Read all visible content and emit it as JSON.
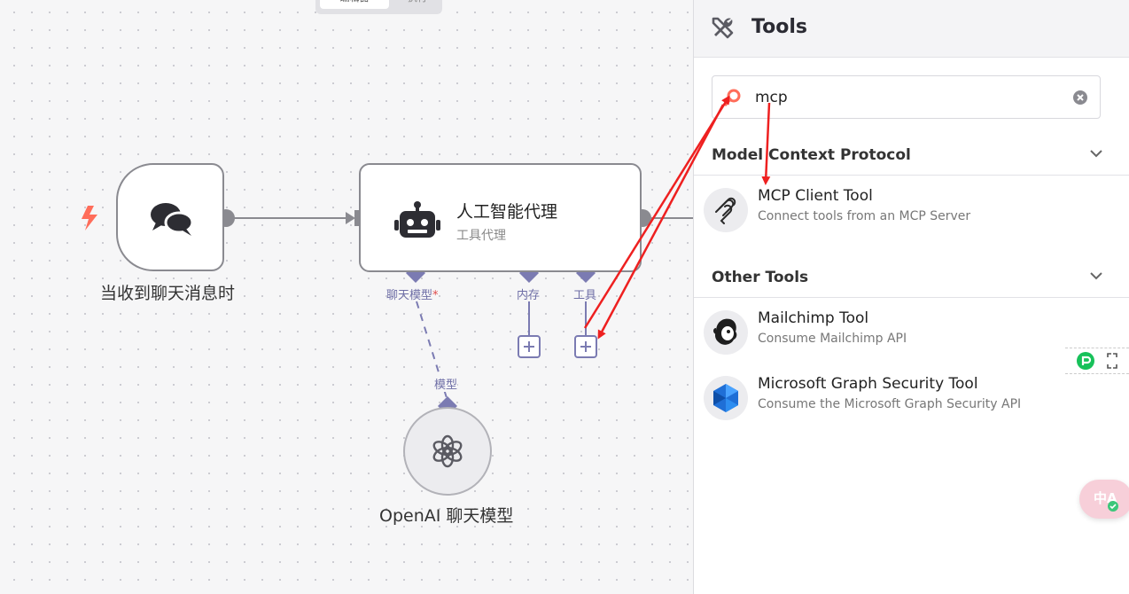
{
  "canvas": {
    "top_tabs": {
      "active": "编辑器",
      "inactive": "执行"
    },
    "trigger_node": {
      "label": "当收到聊天消息时",
      "icon": "chat-bubbles-icon",
      "trigger_icon": "lightning-icon"
    },
    "agent_node": {
      "title": "人工智能代理",
      "subtitle": "工具代理",
      "icon": "robot-icon",
      "ports": {
        "chat_model": "聊天模型",
        "required_mark": "*",
        "memory": "内存",
        "tool": "工具"
      }
    },
    "model_node": {
      "label": "OpenAI 聊天模型",
      "port_label": "模型",
      "icon": "openai-icon"
    }
  },
  "panel": {
    "title": "Tools",
    "header_icon": "tools-icon",
    "search": {
      "value": "mcp",
      "placeholder": "",
      "icon": "search-icon",
      "clear_icon": "clear-icon"
    },
    "sections": [
      {
        "title": "Model Context Protocol",
        "items": [
          {
            "name": "MCP Client Tool",
            "description": "Connect tools from an MCP Server",
            "icon": "mcp-icon"
          }
        ]
      },
      {
        "title": "Other Tools",
        "items": [
          {
            "name": "Mailchimp Tool",
            "description": "Consume Mailchimp API",
            "icon": "mailchimp-icon"
          },
          {
            "name": "Microsoft Graph Security Tool",
            "description": "Consume the Microsoft Graph Security API",
            "icon": "microsoft-graph-icon"
          }
        ]
      }
    ]
  },
  "colors": {
    "accent_red": "#ff6d5a",
    "annotation_red": "#ee2020",
    "port_purple": "#7b7bb2",
    "node_border": "#8a8a90"
  },
  "overlay": {
    "translate_label": "中A"
  }
}
